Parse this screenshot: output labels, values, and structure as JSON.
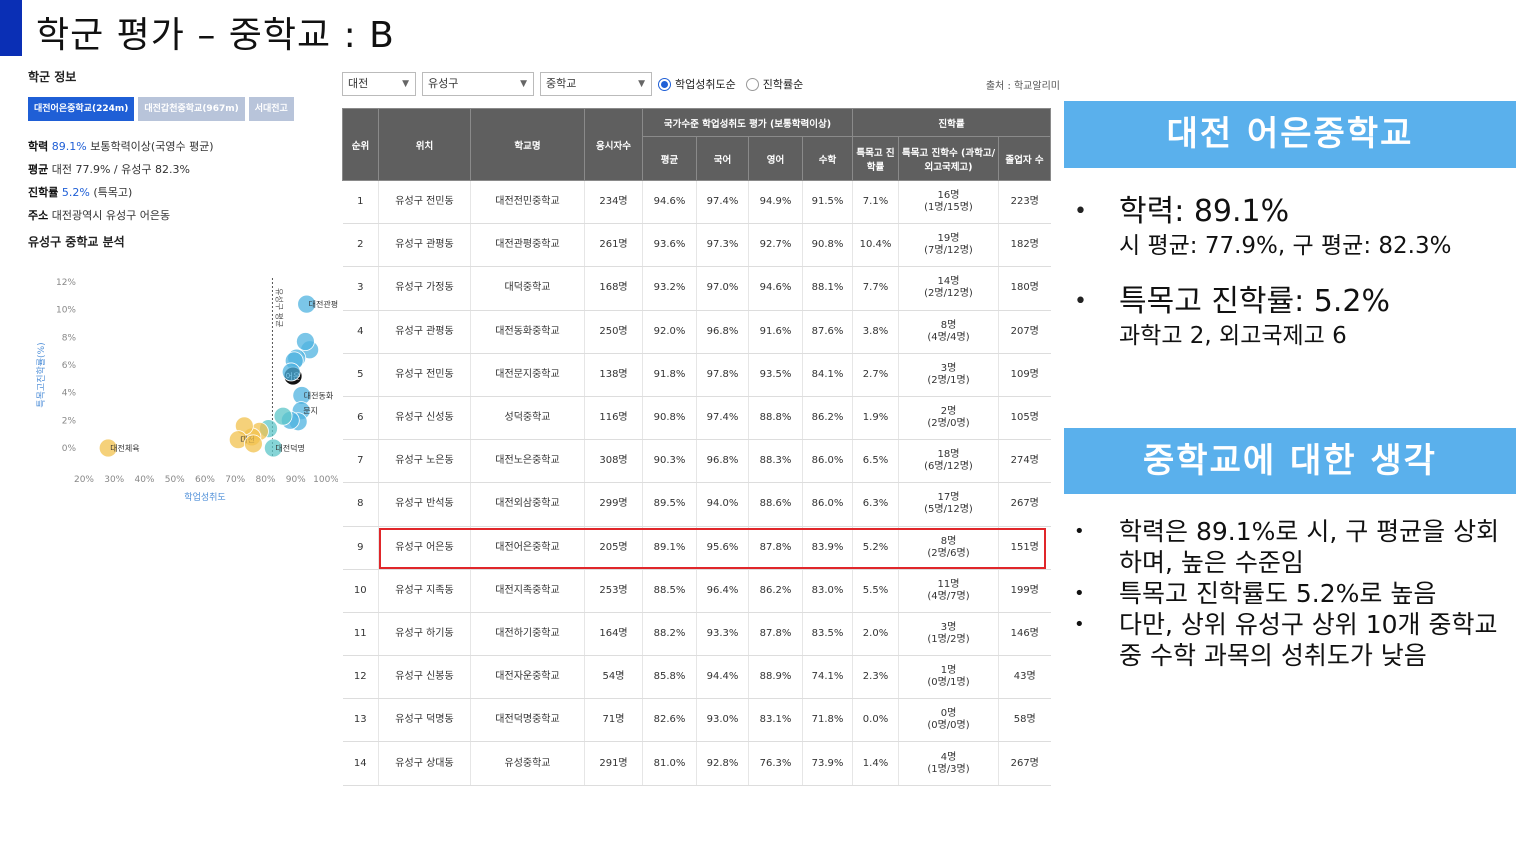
{
  "slide": {
    "title": "학군 평가 – 중학교 : B"
  },
  "left": {
    "heading": "학군 정보",
    "tabs": [
      "대전어은중학교(224m)",
      "대전갑천중학교(967m)",
      "서대전고"
    ],
    "info": {
      "score_label": "학력",
      "score_value": "89.1%",
      "score_desc": "보통학력이상(국영수 평균)",
      "avg_label": "평균",
      "avg_value": "대전 77.9% / 유성구 82.3%",
      "adv_label": "진학률",
      "adv_value": "5.2%",
      "adv_desc": "(특목고)",
      "addr_label": "주소",
      "addr_value": "대전광역시 유성구 어은동"
    },
    "analysis_heading": "유성구 중학교 분석"
  },
  "chart_data": {
    "type": "scatter",
    "xlabel": "학업성취도",
    "ylabel": "특목고진학률(%)",
    "x_ticks": [
      "20%",
      "30%",
      "40%",
      "50%",
      "60%",
      "70%",
      "80%",
      "90%",
      "100%"
    ],
    "y_ticks": [
      "12%",
      "10%",
      "8%",
      "6%",
      "4%",
      "2%",
      "0%"
    ],
    "xlim": [
      20,
      100
    ],
    "ylim": [
      0,
      12
    ],
    "points": [
      {
        "x": 94.6,
        "y": 7.1,
        "label": "",
        "color": "#4fb3e0"
      },
      {
        "x": 93.6,
        "y": 10.4,
        "label": "대전관평",
        "color": "#4fb3e0"
      },
      {
        "x": 93.2,
        "y": 7.7,
        "label": "",
        "color": "#4fb3e0"
      },
      {
        "x": 92.0,
        "y": 3.8,
        "label": "대전동화",
        "color": "#4fb3e0"
      },
      {
        "x": 91.8,
        "y": 2.7,
        "label": "문지",
        "color": "#4fb3e0"
      },
      {
        "x": 90.8,
        "y": 1.9,
        "label": "",
        "color": "#4fb3e0"
      },
      {
        "x": 90.3,
        "y": 6.5,
        "label": "",
        "color": "#4fb3e0"
      },
      {
        "x": 89.5,
        "y": 6.3,
        "label": "",
        "color": "#4fb3e0"
      },
      {
        "x": 89.1,
        "y": 5.2,
        "label": "어은",
        "color": "#111111"
      },
      {
        "x": 88.5,
        "y": 5.5,
        "label": "",
        "color": "#4fb3e0"
      },
      {
        "x": 88.2,
        "y": 2.0,
        "label": "",
        "color": "#4fb3e0"
      },
      {
        "x": 85.8,
        "y": 2.3,
        "label": "",
        "color": "#5cc6c8"
      },
      {
        "x": 82.6,
        "y": 0.0,
        "label": "대전덕명",
        "color": "#5cc6c8"
      },
      {
        "x": 81.0,
        "y": 1.4,
        "label": "",
        "color": "#5cc6c8"
      },
      {
        "x": 78.0,
        "y": 1.2,
        "label": "",
        "color": "#f2c14e"
      },
      {
        "x": 75.5,
        "y": 0.8,
        "label": "",
        "color": "#f2c14e"
      },
      {
        "x": 73.0,
        "y": 1.6,
        "label": "",
        "color": "#f2c14e"
      },
      {
        "x": 71.0,
        "y": 0.6,
        "label": "대전",
        "color": "#f2c14e"
      },
      {
        "x": 76.0,
        "y": 0.3,
        "label": "",
        "color": "#f2c14e"
      },
      {
        "x": 28.0,
        "y": 0.0,
        "label": "대전체육",
        "color": "#f2c14e"
      }
    ],
    "ref_line_x": 82.3,
    "ref_line_label": "유성구 평균"
  },
  "toolbar": {
    "city": "대전",
    "district": "유성구",
    "level": "중학교",
    "radio1": "학업성취도순",
    "radio2": "진학률순",
    "source": "출처 : 학교알리미"
  },
  "table": {
    "h_rank": "순위",
    "h_loc": "위치",
    "h_name": "학교명",
    "h_students": "응시자수",
    "h_group1": "국가수준 학업성취도 평가 (보통학력이상)",
    "h_group2": "진학률",
    "h_avg": "평균",
    "h_kor": "국어",
    "h_eng": "영어",
    "h_math": "수학",
    "h_adv_rate": "특목고 진학률",
    "h_adv_cnt": "특목고 진학수 (과학고/외고국제고)",
    "h_grad": "졸업자 수",
    "rows": [
      {
        "rank": "1",
        "loc": "유성구 전민동",
        "name": "대전전민중학교",
        "students": "234명",
        "avg": "94.6%",
        "kor": "97.4%",
        "eng": "94.9%",
        "math": "91.5%",
        "rate": "7.1%",
        "cnt": "16명",
        "cnt2": "(1명/15명)",
        "grad": "223명"
      },
      {
        "rank": "2",
        "loc": "유성구 관평동",
        "name": "대전관평중학교",
        "students": "261명",
        "avg": "93.6%",
        "kor": "97.3%",
        "eng": "92.7%",
        "math": "90.8%",
        "rate": "10.4%",
        "cnt": "19명",
        "cnt2": "(7명/12명)",
        "grad": "182명"
      },
      {
        "rank": "3",
        "loc": "유성구 가정동",
        "name": "대덕중학교",
        "students": "168명",
        "avg": "93.2%",
        "kor": "97.0%",
        "eng": "94.6%",
        "math": "88.1%",
        "rate": "7.7%",
        "cnt": "14명",
        "cnt2": "(2명/12명)",
        "grad": "180명"
      },
      {
        "rank": "4",
        "loc": "유성구 관평동",
        "name": "대전동화중학교",
        "students": "250명",
        "avg": "92.0%",
        "kor": "96.8%",
        "eng": "91.6%",
        "math": "87.6%",
        "rate": "3.8%",
        "cnt": "8명",
        "cnt2": "(4명/4명)",
        "grad": "207명"
      },
      {
        "rank": "5",
        "loc": "유성구 전민동",
        "name": "대전문지중학교",
        "students": "138명",
        "avg": "91.8%",
        "kor": "97.8%",
        "eng": "93.5%",
        "math": "84.1%",
        "rate": "2.7%",
        "cnt": "3명",
        "cnt2": "(2명/1명)",
        "grad": "109명"
      },
      {
        "rank": "6",
        "loc": "유성구 신성동",
        "name": "성덕중학교",
        "students": "116명",
        "avg": "90.8%",
        "kor": "97.4%",
        "eng": "88.8%",
        "math": "86.2%",
        "rate": "1.9%",
        "cnt": "2명",
        "cnt2": "(2명/0명)",
        "grad": "105명"
      },
      {
        "rank": "7",
        "loc": "유성구 노은동",
        "name": "대전노은중학교",
        "students": "308명",
        "avg": "90.3%",
        "kor": "96.8%",
        "eng": "88.3%",
        "math": "86.0%",
        "rate": "6.5%",
        "cnt": "18명",
        "cnt2": "(6명/12명)",
        "grad": "274명"
      },
      {
        "rank": "8",
        "loc": "유성구 반석동",
        "name": "대전외삼중학교",
        "students": "299명",
        "avg": "89.5%",
        "kor": "94.0%",
        "eng": "88.6%",
        "math": "86.0%",
        "rate": "6.3%",
        "cnt": "17명",
        "cnt2": "(5명/12명)",
        "grad": "267명"
      },
      {
        "rank": "9",
        "loc": "유성구 어은동",
        "name": "대전어은중학교",
        "students": "205명",
        "avg": "89.1%",
        "kor": "95.6%",
        "eng": "87.8%",
        "math": "83.9%",
        "rate": "5.2%",
        "cnt": "8명",
        "cnt2": "(2명/6명)",
        "grad": "151명"
      },
      {
        "rank": "10",
        "loc": "유성구 지족동",
        "name": "대전지족중학교",
        "students": "253명",
        "avg": "88.5%",
        "kor": "96.4%",
        "eng": "86.2%",
        "math": "83.0%",
        "rate": "5.5%",
        "cnt": "11명",
        "cnt2": "(4명/7명)",
        "grad": "199명"
      },
      {
        "rank": "11",
        "loc": "유성구 하기동",
        "name": "대전하기중학교",
        "students": "164명",
        "avg": "88.2%",
        "kor": "93.3%",
        "eng": "87.8%",
        "math": "83.5%",
        "rate": "2.0%",
        "cnt": "3명",
        "cnt2": "(1명/2명)",
        "grad": "146명"
      },
      {
        "rank": "12",
        "loc": "유성구 신봉동",
        "name": "대전자운중학교",
        "students": "54명",
        "avg": "85.8%",
        "kor": "94.4%",
        "eng": "88.9%",
        "math": "74.1%",
        "rate": "2.3%",
        "cnt": "1명",
        "cnt2": "(0명/1명)",
        "grad": "43명"
      },
      {
        "rank": "13",
        "loc": "유성구 덕명동",
        "name": "대전덕명중학교",
        "students": "71명",
        "avg": "82.6%",
        "kor": "93.0%",
        "eng": "83.1%",
        "math": "71.8%",
        "rate": "0.0%",
        "cnt": "0명",
        "cnt2": "(0명/0명)",
        "grad": "58명"
      },
      {
        "rank": "14",
        "loc": "유성구 상대동",
        "name": "유성중학교",
        "students": "291명",
        "avg": "81.0%",
        "kor": "92.8%",
        "eng": "76.3%",
        "math": "73.9%",
        "rate": "1.4%",
        "cnt": "4명",
        "cnt2": "(1명/3명)",
        "grad": "267명"
      }
    ]
  },
  "right": {
    "heading1": "대전 어은중학교",
    "b1_main": "학력: 89.1%",
    "b1_sub": "시 평균: 77.9%, 구 평균: 82.3%",
    "b2_main": "특목고 진학률: 5.2%",
    "b2_sub": "과학고 2, 외고국제고 6",
    "heading2": "중학교에 대한 생각",
    "thoughts": [
      "학력은 89.1%로 시, 구 평균을 상회하며, 높은 수준임",
      "특목고 진학률도 5.2%로 높음",
      "다만, 상위 유성구 상위 10개 중학교 중 수학 과목의 성취도가 낮음"
    ],
    "bullet_char": "•"
  }
}
